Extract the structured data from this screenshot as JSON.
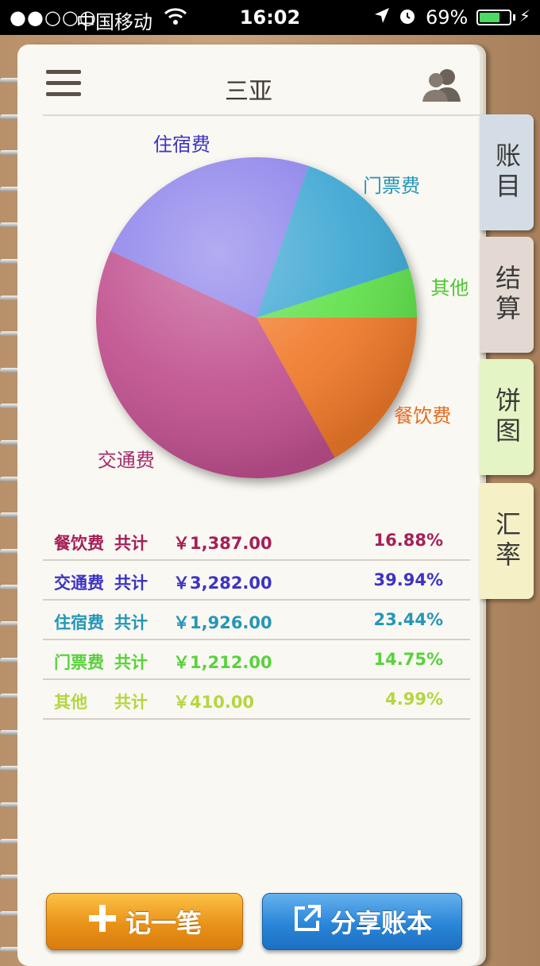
{
  "status_bar": {
    "signal": "●●○○○",
    "carrier": "中国移动",
    "time": "16:02",
    "battery": "69%",
    "battery_level": 0.69
  },
  "header": {
    "title": "三亚"
  },
  "side_tabs": [
    {
      "label": "账目",
      "color": "#d4dde6"
    },
    {
      "label": "结算",
      "color": "#e4d9d2"
    },
    {
      "label": "饼图",
      "color": "#e4f4c4"
    },
    {
      "label": "汇率",
      "color": "#f6f0c6"
    }
  ],
  "chart_data": {
    "type": "pie",
    "slices": [
      {
        "label": "餐饮费",
        "value": 1387.0,
        "percent": 16.88,
        "color": "#f07a2a"
      },
      {
        "label": "交通费",
        "value": 3282.0,
        "percent": 39.94,
        "color": "#c0508e"
      },
      {
        "label": "住宿费",
        "value": 1926.0,
        "percent": 23.44,
        "color": "#8a80ea"
      },
      {
        "label": "门票费",
        "value": 1212.0,
        "percent": 14.75,
        "color": "#3aa6d2"
      },
      {
        "label": "其他",
        "value": 410.0,
        "percent": 4.99,
        "color": "#5ee048"
      }
    ]
  },
  "summary": {
    "total_label": "共计",
    "currency": "￥",
    "rows": [
      {
        "category": "餐饮费",
        "amount": "1,387.00",
        "percent": "16.88%",
        "color": "#a51f58"
      },
      {
        "category": "交通费",
        "amount": "3,282.00",
        "percent": "39.94%",
        "color": "#3c34c4"
      },
      {
        "category": "住宿费",
        "amount": "1,926.00",
        "percent": "23.44%",
        "color": "#2496b8"
      },
      {
        "category": "门票费",
        "amount": "1,212.00",
        "percent": "14.75%",
        "color": "#58d23c"
      },
      {
        "category": "其他",
        "amount": "410.00",
        "percent": "4.99%",
        "color": "#b4d640"
      }
    ]
  },
  "buttons": {
    "add_label": "记一笔",
    "share_label": "分享账本"
  },
  "icons": {
    "menu": "menu-icon",
    "user": "users-icon",
    "add": "plus-icon",
    "share": "share-icon"
  }
}
